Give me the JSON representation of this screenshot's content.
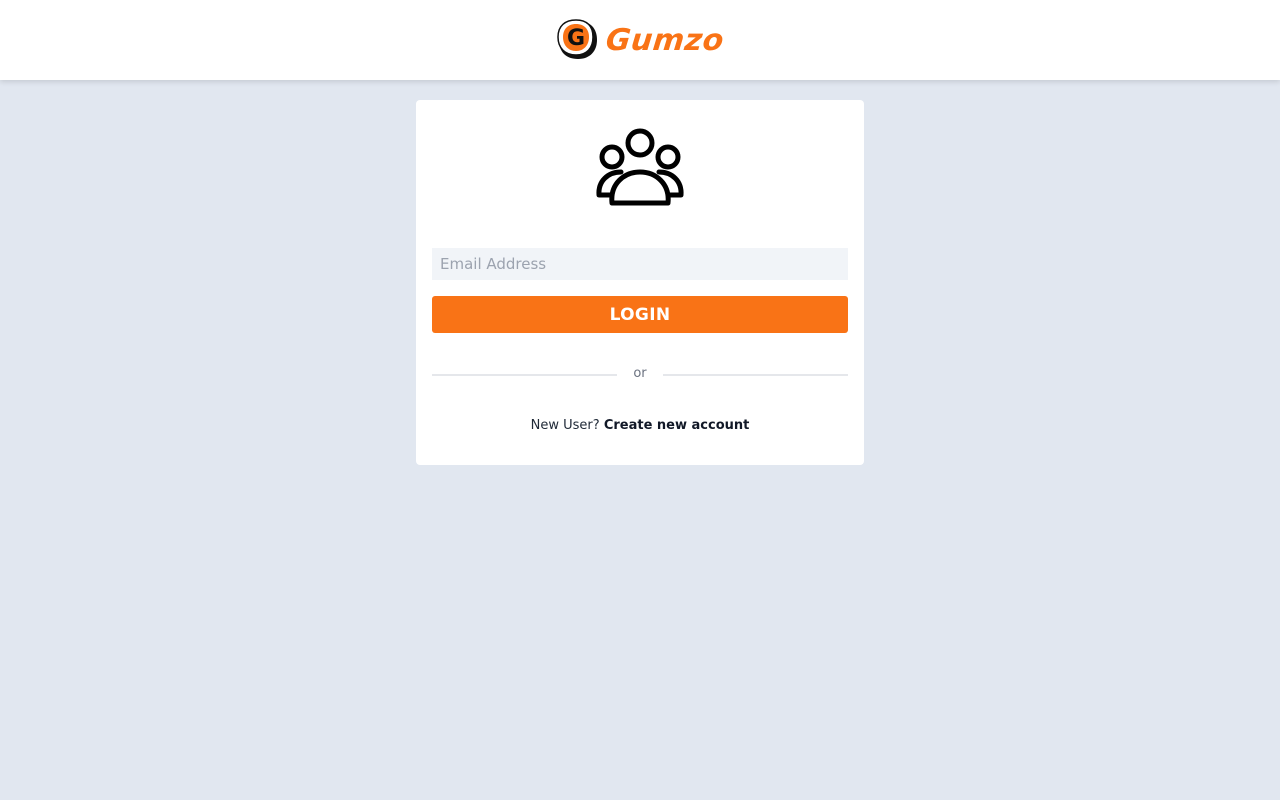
{
  "header": {
    "brand_name": "Gumzo",
    "logo_letter": "G",
    "logo_icon": "gumzo-logo-icon"
  },
  "login_card": {
    "avatar_icon": "users-group-icon",
    "email_field": {
      "placeholder": "Email Address",
      "value": ""
    },
    "login_button_label": "LOGIN",
    "divider_text": "or",
    "signup_prompt": "New User?",
    "signup_link_label": "Create new account"
  },
  "colors": {
    "accent": "#f97316",
    "page_background": "#e1e7f0",
    "card_background": "#ffffff",
    "input_background": "#f1f4f8"
  }
}
